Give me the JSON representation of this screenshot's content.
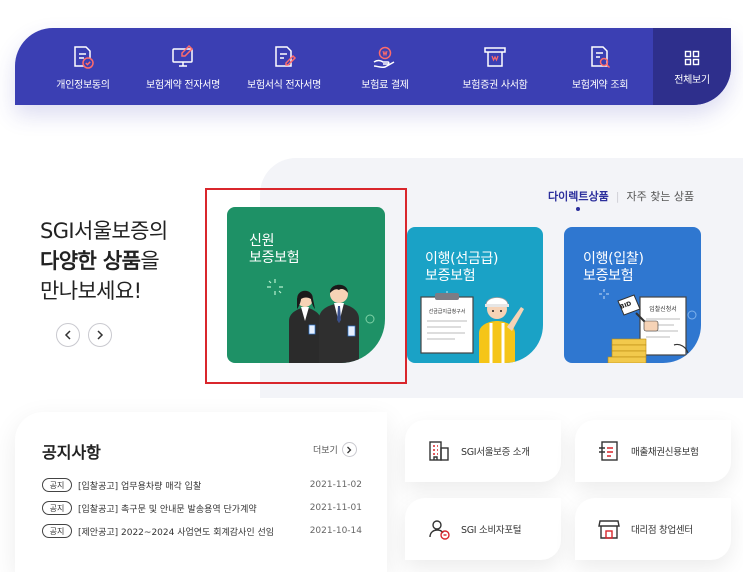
{
  "nav": {
    "items": [
      {
        "label": "개인정보동의",
        "icon": "document-check-icon"
      },
      {
        "label": "보험계약 전자서명",
        "icon": "monitor-pen-icon"
      },
      {
        "label": "보험서식 전자서명",
        "icon": "document-pen-icon"
      },
      {
        "label": "보험료 결제",
        "icon": "hand-coin-icon"
      },
      {
        "label": "보험증권 사서함",
        "icon": "certificate-tray-icon"
      },
      {
        "label": "보험계약 조회",
        "icon": "document-search-icon"
      }
    ],
    "all_label": "전체보기",
    "colors": {
      "bar": "#3b3fb3",
      "all_bg": "#2e2f8c"
    }
  },
  "hero": {
    "line1": "SGI서울보증의",
    "line2_strong": "다양한 상품",
    "line2_rest": "을",
    "line3": "만나보세요!",
    "prev_label": "‹",
    "next_label": "›",
    "tabs": {
      "active": "다이렉트상품",
      "separator": "|",
      "other": "자주 찾는 상품"
    },
    "cards": [
      {
        "title_l1": "신원",
        "title_l2": "보증보험",
        "color": "#1e9166"
      },
      {
        "title_l1": "이행(선금급)",
        "title_l2": "보증보험",
        "color": "#1aa2c6",
        "doc_text": "선금급지급청구서"
      },
      {
        "title_l1": "이행(입찰)",
        "title_l2": "보증보험",
        "color": "#2f77d0",
        "doc_text": "입찰신청서",
        "tag_text": "BID"
      }
    ],
    "highlight_color": "#d9262c"
  },
  "notice": {
    "title": "공지사항",
    "more_label": "더보기",
    "rows": [
      {
        "badge": "공지",
        "text": "[입찰공고] 업무용차량 매각 입찰",
        "date": "2021-11-02"
      },
      {
        "badge": "공지",
        "text": "[입찰공고] 촉구문 및 안내문 발송용역 단가계약",
        "date": "2021-11-01"
      },
      {
        "badge": "공지",
        "text": "[제안공고] 2022~2024 사업연도 회계감사인 선임",
        "date": "2021-10-14"
      }
    ]
  },
  "quick_links": [
    {
      "label": "SGI서울보증 소개",
      "icon": "building-icon"
    },
    {
      "label": "매출채권신용보험",
      "icon": "credit-insurance-icon"
    },
    {
      "label": "SGI 소비자포털",
      "icon": "consumer-person-icon"
    },
    {
      "label": "대리점 창업센터",
      "icon": "storefront-icon"
    }
  ]
}
